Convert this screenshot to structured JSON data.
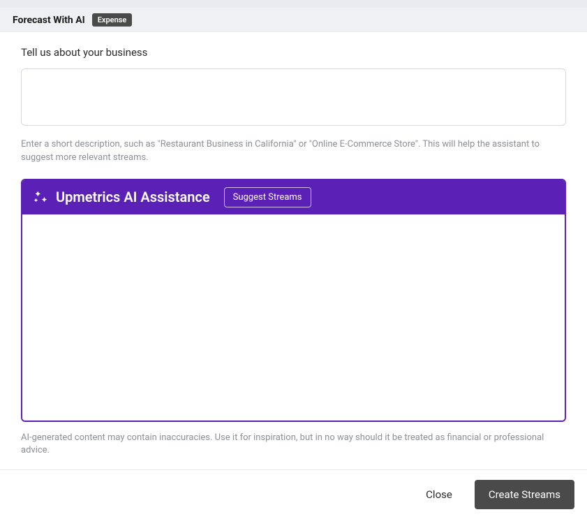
{
  "header": {
    "title": "Forecast With AI",
    "badge": "Expense"
  },
  "business": {
    "label": "Tell us about your business",
    "value": "",
    "helper": "Enter a short description, such as \"Restaurant Business in California\" or \"Online E-Commerce Store\". This will help the assistant to suggest more relevant streams."
  },
  "ai_panel": {
    "title": "Upmetrics AI Assistance",
    "suggest_label": "Suggest Streams",
    "disclaimer": "AI-generated content may contain inaccuracies. Use it for inspiration, but in no way should it be treated as financial or professional advice."
  },
  "footer": {
    "close_label": "Close",
    "create_label": "Create Streams"
  },
  "colors": {
    "accent": "#5b21b6"
  }
}
